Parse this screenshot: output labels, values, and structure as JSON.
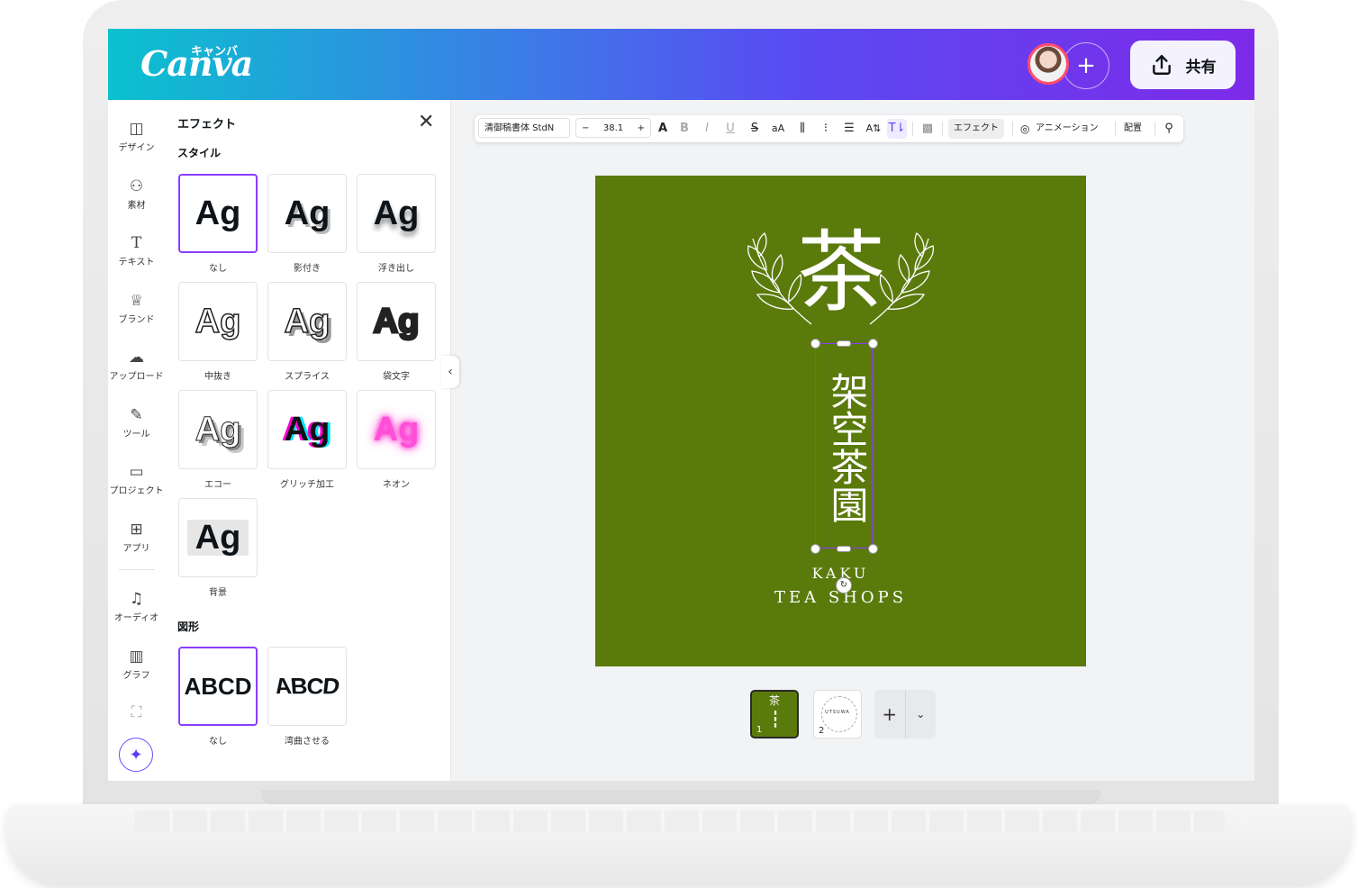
{
  "header": {
    "logo": "Canva",
    "logo_kana": "キャンバ",
    "add_person": "+",
    "share_label": "共有"
  },
  "rail": [
    {
      "label": "デザイン",
      "icon": "design-icon"
    },
    {
      "label": "素材",
      "icon": "elements-icon"
    },
    {
      "label": "テキスト",
      "icon": "text-icon"
    },
    {
      "label": "ブランド",
      "icon": "brand-icon"
    },
    {
      "label": "アップロード",
      "icon": "upload-icon"
    },
    {
      "label": "ツール",
      "icon": "draw-icon"
    },
    {
      "label": "プロジェクト",
      "icon": "folder-icon"
    },
    {
      "label": "アプリ",
      "icon": "apps-icon"
    },
    {
      "label": "オーディオ",
      "icon": "audio-icon"
    },
    {
      "label": "グラフ",
      "icon": "chart-icon"
    }
  ],
  "panel": {
    "title": "エフェクト",
    "style_section": "スタイル",
    "styles": [
      {
        "sample": "Ag",
        "label": "なし"
      },
      {
        "sample": "Ag",
        "label": "影付き"
      },
      {
        "sample": "Ag",
        "label": "浮き出し"
      },
      {
        "sample": "Ag",
        "label": "中抜き"
      },
      {
        "sample": "Ag",
        "label": "スプライス"
      },
      {
        "sample": "Ag",
        "label": "袋文字"
      },
      {
        "sample": "Ag",
        "label": "エコー"
      },
      {
        "sample": "Ag",
        "label": "グリッチ加工"
      },
      {
        "sample": "Ag",
        "label": "ネオン"
      },
      {
        "sample": "Ag",
        "label": "背景"
      }
    ],
    "shape_section": "図形",
    "shapes": [
      {
        "sample": "ABCD",
        "label": "なし"
      },
      {
        "sample": "ABCD",
        "label": "湾曲させる"
      }
    ]
  },
  "toolbar": {
    "font": "清御稿書体 StdN",
    "size_minus": "−",
    "font_size": "38.1",
    "size_plus": "+",
    "effects": "エフェクト",
    "animate": "アニメーション",
    "position": "配置"
  },
  "design": {
    "big_char": "茶",
    "vertical_text": "架空茶園",
    "line1": "KAKU",
    "line2": "TEA SHOPS",
    "background": "#5a7a0c"
  },
  "pages": [
    {
      "number": "1",
      "mini": "茶"
    },
    {
      "number": "2",
      "mini": "UTSUWA"
    }
  ],
  "colors": {
    "accent": "#8b3dff",
    "header_start": "#0bc1cf",
    "header_end": "#7d2ae8"
  }
}
